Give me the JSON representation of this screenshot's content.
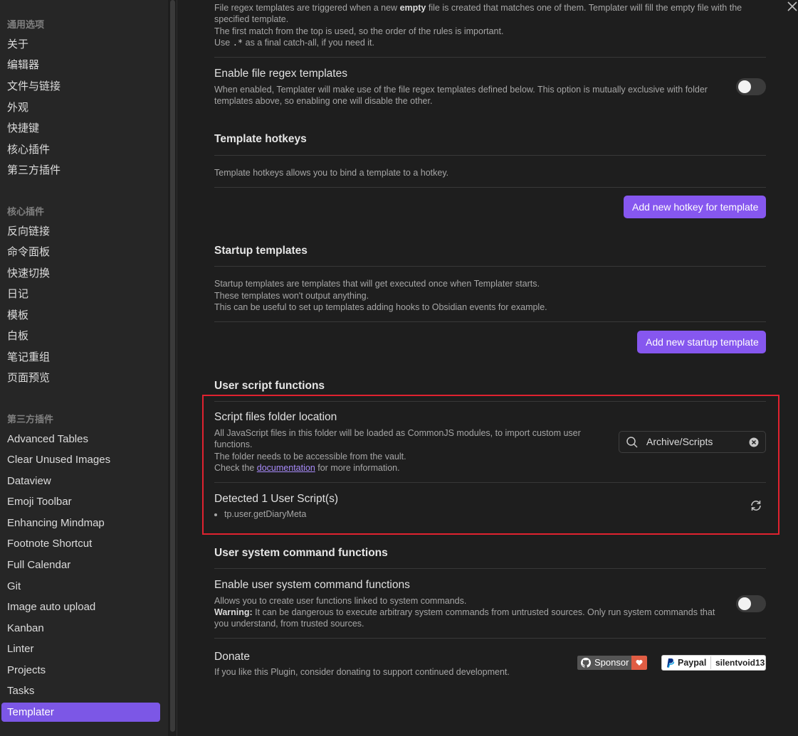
{
  "sidebar": {
    "section_general": "通用选项",
    "general_items": [
      "关于",
      "编辑器",
      "文件与链接",
      "外观",
      "快捷键",
      "核心插件",
      "第三方插件"
    ],
    "section_core": "核心插件",
    "core_items": [
      "反向链接",
      "命令面板",
      "快速切换",
      "日记",
      "模板",
      "白板",
      "笔记重组",
      "页面预览"
    ],
    "section_third": "第三方插件",
    "third_items": [
      "Advanced Tables",
      "Clear Unused Images",
      "Dataview",
      "Emoji Toolbar",
      "Enhancing Mindmap",
      "Footnote Shortcut",
      "Full Calendar",
      "Git",
      "Image auto upload",
      "Kanban",
      "Linter",
      "Projects",
      "Tasks",
      "Templater"
    ],
    "active_item": "Templater"
  },
  "main": {
    "intro": {
      "line1_a": "File regex templates are triggered when a new ",
      "line1_bold": "empty",
      "line1_b": " file is created that matches one of them. Templater will fill the empty file with the",
      "line2": "specified template.",
      "line3": "The first match from the top is used, so the order of the rules is important.",
      "line4_a": "Use ",
      "line4_code": ".*",
      "line4_b": " as a final catch-all, if you need it."
    },
    "file_regex": {
      "name": "Enable file regex templates",
      "desc1": "When enabled, Templater will make use of the file regex templates defined below. This option is mutually exclusive with folder",
      "desc2": "templates above, so enabling one will disable the other.",
      "enabled": false
    },
    "hotkeys": {
      "heading": "Template hotkeys",
      "desc": "Template hotkeys allows you to bind a template to a hotkey.",
      "button": "Add new hotkey for template"
    },
    "startup": {
      "heading": "Startup templates",
      "desc1": "Startup templates are templates that will get executed once when Templater starts.",
      "desc2": "These templates won't output anything.",
      "desc3": "This can be useful to set up templates adding hooks to Obsidian events for example.",
      "button": "Add new startup template"
    },
    "user_script": {
      "heading": "User script functions",
      "folder_name": "Script files folder location",
      "folder_desc1": "All JavaScript files in this folder will be loaded as CommonJS modules, to import custom user",
      "folder_desc2": "functions.",
      "folder_desc3": "The folder needs to be accessible from the vault.",
      "folder_desc4_a": "Check the ",
      "folder_desc4_link": "documentation",
      "folder_desc4_b": " for more information.",
      "folder_value": "Archive/Scripts",
      "detected_name": "Detected 1 User Script(s)",
      "scripts": [
        "tp.user.getDiaryMeta"
      ]
    },
    "user_system": {
      "heading": "User system command functions",
      "name": "Enable user system command functions",
      "desc1": "Allows you to create user functions linked to system commands.",
      "desc2_bold": "Warning:",
      "desc2": " It can be dangerous to execute arbitrary system commands from untrusted sources. Only run system commands that",
      "desc3": "you understand, from trusted sources.",
      "enabled": false
    },
    "donate": {
      "name": "Donate",
      "desc": "If you like this Plugin, consider donating to support continued development.",
      "sponsor_label": "Sponsor",
      "paypal_label": "Paypal",
      "paypal_user": "silentvoid13"
    }
  },
  "colors": {
    "accent": "#8657ef",
    "highlight_box": "#e0222f"
  }
}
